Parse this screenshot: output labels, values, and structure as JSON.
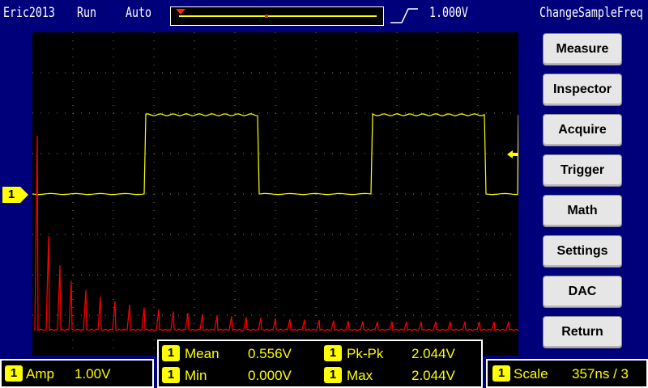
{
  "topbar": {
    "device_name": "Eric2013",
    "run_state": "Run",
    "trigger_mode": "Auto",
    "trigger_level": "1.000V",
    "sample_label": "ChangeSampleFreq"
  },
  "channel": {
    "marker_label": "1"
  },
  "menu": [
    {
      "label": "Measure"
    },
    {
      "label": "Inspector"
    },
    {
      "label": "Acquire"
    },
    {
      "label": "Trigger"
    },
    {
      "label": "Math"
    },
    {
      "label": "Settings"
    },
    {
      "label": "DAC"
    },
    {
      "label": "Return"
    }
  ],
  "status": {
    "amp": {
      "channel": "1",
      "label": "Amp",
      "value": "1.00V"
    },
    "measurements": [
      {
        "channel": "1",
        "label": "Mean",
        "value": "0.556V"
      },
      {
        "channel": "1",
        "label": "Pk-Pk",
        "value": "2.044V"
      },
      {
        "channel": "1",
        "label": "Min",
        "value": "0.000V"
      },
      {
        "channel": "1",
        "label": "Max",
        "value": "2.044V"
      }
    ],
    "scale": {
      "channel": "1",
      "label": "Scale",
      "value": "357ns / 3"
    }
  },
  "colors": {
    "background": "#00007b",
    "trace_channel1": "#ffff00",
    "trace_fft": "#ff0000",
    "button_bg": "#e6e6e6"
  }
}
